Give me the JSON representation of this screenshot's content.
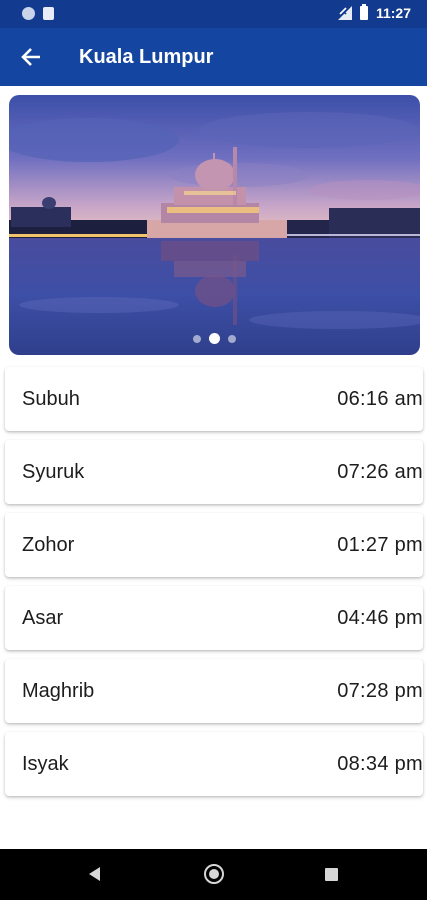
{
  "status_bar": {
    "time": "11:27",
    "icons": [
      "notification-dot-icon",
      "sd-card-icon",
      "signal-icon",
      "battery-icon"
    ]
  },
  "app_bar": {
    "back_icon": "arrow-back-icon",
    "title": "Kuala Lumpur",
    "background_color": "#1445a0"
  },
  "banner": {
    "image": "mosque-at-dusk-photo",
    "page_indicator": {
      "count": 3,
      "active_index": 1
    }
  },
  "prayer_times": [
    {
      "name": "Subuh",
      "time": "06:16 am"
    },
    {
      "name": "Syuruk",
      "time": "07:26 am"
    },
    {
      "name": "Zohor",
      "time": "01:27 pm"
    },
    {
      "name": "Asar",
      "time": "04:46 pm"
    },
    {
      "name": "Maghrib",
      "time": "07:28 pm"
    },
    {
      "name": "Isyak",
      "time": "08:34 pm"
    }
  ],
  "nav_bar": {
    "icons": [
      "nav-back-icon",
      "nav-home-icon",
      "nav-recents-icon"
    ]
  }
}
